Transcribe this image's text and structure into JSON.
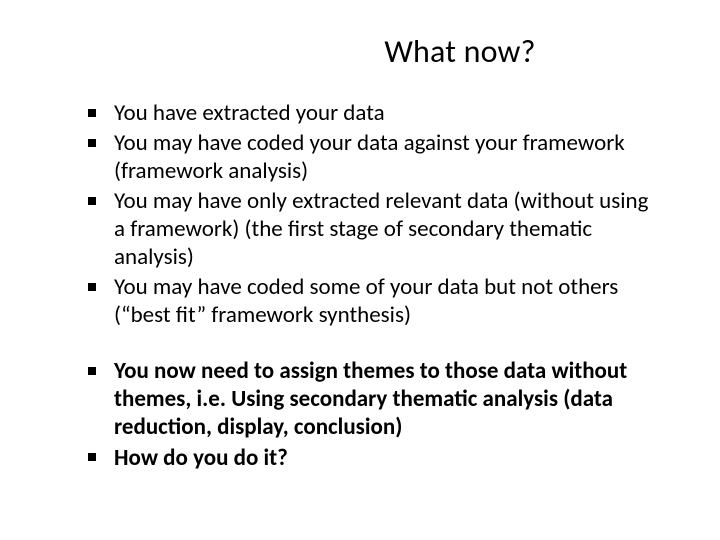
{
  "title": "What now?",
  "group1": {
    "items": [
      "You have extracted your data",
      "You may have coded your data against your framework (framework analysis)",
      "You may have only extracted relevant data (without using a framework) (the first stage of secondary thematic analysis)",
      "You may have coded some of your data but not others (“best fit” framework synthesis)"
    ]
  },
  "group2": {
    "items": [
      "You now need to assign themes to those data without themes, i.e. Using secondary thematic analysis (data reduction, display, conclusion)",
      "How do you do it?"
    ]
  }
}
